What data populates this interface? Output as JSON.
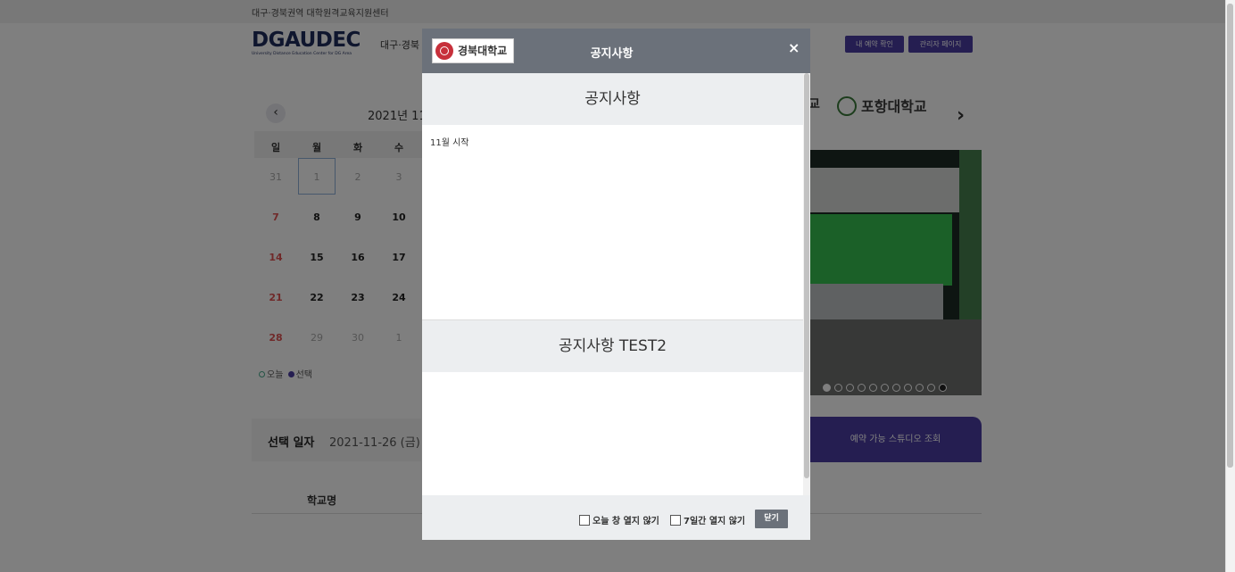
{
  "header": {
    "top_text": "대구·경북권역 대학원격교육지원센터",
    "logo_text": "DGAUDEC",
    "logo_sub": "University Distance Education Center for DG Area",
    "site_name": "대구·경북",
    "btn_my_reservation": "내 예약 확인",
    "btn_admin": "관리자 페이지"
  },
  "calendar": {
    "prev_label": "‹",
    "title": "2021년 11",
    "weekdays": [
      "일",
      "월",
      "화",
      "수"
    ],
    "weeks": [
      [
        "31",
        "1",
        "2",
        "3"
      ],
      [
        "7",
        "8",
        "9",
        "10"
      ],
      [
        "14",
        "15",
        "16",
        "17"
      ],
      [
        "21",
        "22",
        "23",
        "24"
      ],
      [
        "28",
        "29",
        "30",
        "1"
      ]
    ],
    "legend_today": "오늘",
    "legend_selected": "선택",
    "today_color": "#49a98d",
    "selected_color": "#4a3ca3"
  },
  "selected_date": {
    "label": "선택 일자",
    "value": "2021-11-26 (금)"
  },
  "table": {
    "school_header": "학교명"
  },
  "slider": {
    "partial_logo_text": "교",
    "pohang_logo_text": "포항대학교",
    "next_label": "›",
    "reserve_button": "예약 가능 스튜디오 조회"
  },
  "modal": {
    "logo_text": "경북대학교",
    "title": "공지사항",
    "close_icon": "×",
    "notices": [
      {
        "title": "공지사항",
        "content": "11월 시작"
      },
      {
        "title": "공지사항 TEST2",
        "content": ""
      }
    ],
    "checkbox_today": "오늘 창 열지 않기",
    "checkbox_week": "7일간 열지 않기",
    "close_button": "닫기"
  },
  "colors": {
    "brand": "#4a3ca3",
    "modal_header": "#6b717a",
    "sunday": "#e05353"
  }
}
